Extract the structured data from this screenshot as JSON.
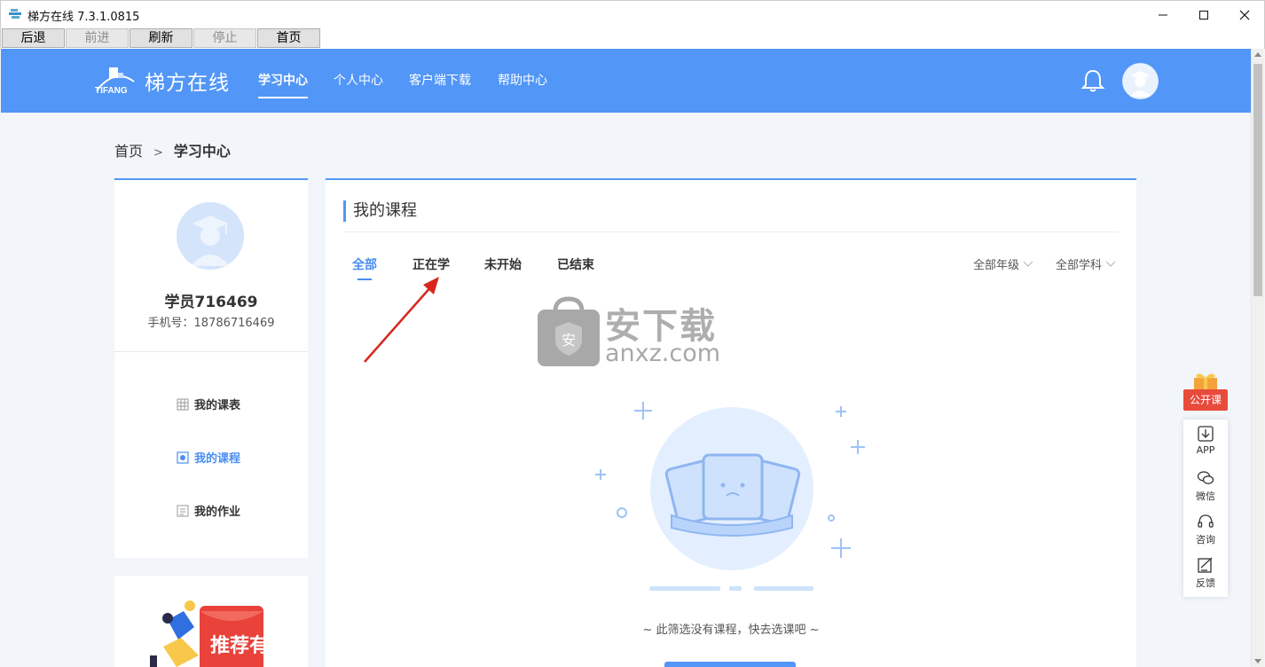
{
  "window": {
    "title": "梯方在线 7.3.1.0815"
  },
  "toolbar": {
    "back": "后退",
    "forward": "前进",
    "refresh": "刷新",
    "stop": "停止",
    "home": "首页"
  },
  "header": {
    "logo_text": "梯方在线",
    "logo_sub": "TIFANG",
    "nav": [
      "学习中心",
      "个人中心",
      "客户端下载",
      "帮助中心"
    ]
  },
  "breadcrumb": {
    "home": "首页",
    "sep": ">",
    "current": "学习中心"
  },
  "profile": {
    "name": "学员716469",
    "phone": "手机号：18786716469",
    "menu": [
      "我的课表",
      "我的课程",
      "我的作业"
    ]
  },
  "main": {
    "title": "我的课程",
    "tabs": [
      "全部",
      "正在学",
      "未开始",
      "已结束"
    ],
    "filters": [
      "全部年级",
      "全部学科"
    ],
    "empty_text": "~ 此筛选没有课程，快去选课吧 ~"
  },
  "watermark": {
    "cn": "安下载",
    "site": "anxz.com",
    "badge": "安"
  },
  "promo": {
    "text": "推荐有礼"
  },
  "floatbar": {
    "gift": "公开课",
    "items": [
      "APP",
      "微信",
      "咨询",
      "反馈"
    ]
  },
  "colors": {
    "brand": "#5296f7",
    "active": "#4a8ef2",
    "gift": "#e84a3c"
  }
}
